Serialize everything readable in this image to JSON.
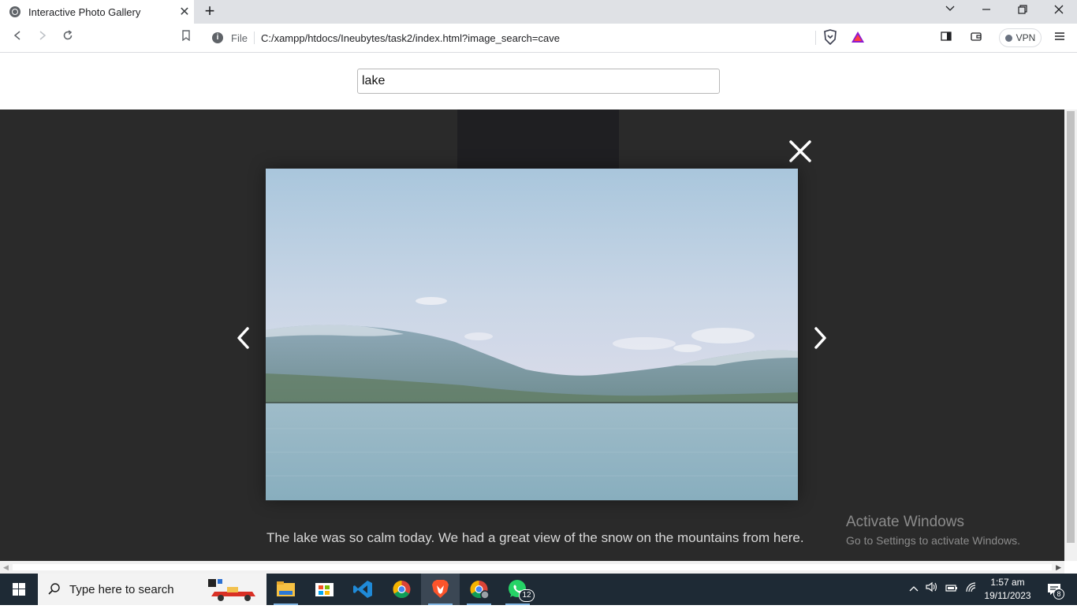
{
  "browser": {
    "tab_title": "Interactive Photo Gallery",
    "url_scheme": "File",
    "url": "C:/xampp/htdocs/Ineubytes/task2/index.html?image_search=cave",
    "vpn_label": "VPN"
  },
  "gallery": {
    "search_value": "lake",
    "caption": "The lake was so calm today. We had a great view of the snow on the mountains from here."
  },
  "watermark": {
    "line1": "Activate Windows",
    "line2": "Go to Settings to activate Windows."
  },
  "taskbar": {
    "search_placeholder": "Type here to search",
    "whatsapp_badge": "12",
    "notification_badge": "8",
    "time": "1:57 am",
    "date": "19/11/2023"
  }
}
